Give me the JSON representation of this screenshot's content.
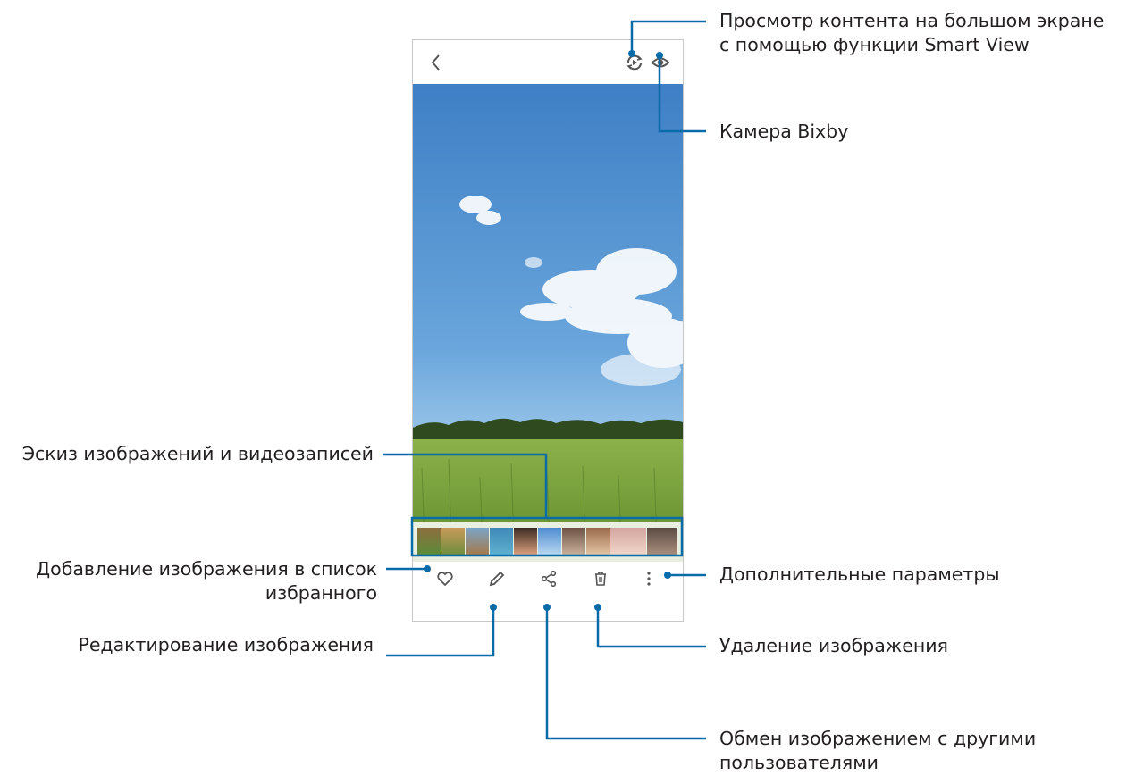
{
  "gallery_view": {
    "toolbar": {
      "back_icon": "chevron-left-icon",
      "smart_view_icon": "smart-view-icon",
      "bixby_vision_icon": "eye-icon"
    },
    "bottom_bar": {
      "favorite_icon": "heart-icon",
      "edit_icon": "pencil-icon",
      "share_icon": "share-icon",
      "delete_icon": "trash-icon",
      "more_icon": "more-vertical-icon"
    },
    "thumbnail_count": 10
  },
  "callouts": {
    "smart_view": {
      "line1": "Просмотр контента на большом экране",
      "line2": "с помощью функции Smart View"
    },
    "bixby_vision": {
      "line1": "Камера Bixby"
    },
    "thumbnails": {
      "line1": "Эскиз изображений и видеозаписей"
    },
    "favorite": {
      "line1": "Добавление изображения в список",
      "line2": "избранного"
    },
    "more_options": {
      "line1": "Дополнительные параметры"
    },
    "edit": {
      "line1": "Редактирование изображения"
    },
    "delete": {
      "line1": "Удаление изображения"
    },
    "share": {
      "line1": "Обмен изображением с другими",
      "line2": "пользователями"
    }
  },
  "colors": {
    "callout_line": "#0a6ba9",
    "text": "#231f20",
    "sky_top": "#3e7fc5",
    "grass": "#7fa63c"
  }
}
